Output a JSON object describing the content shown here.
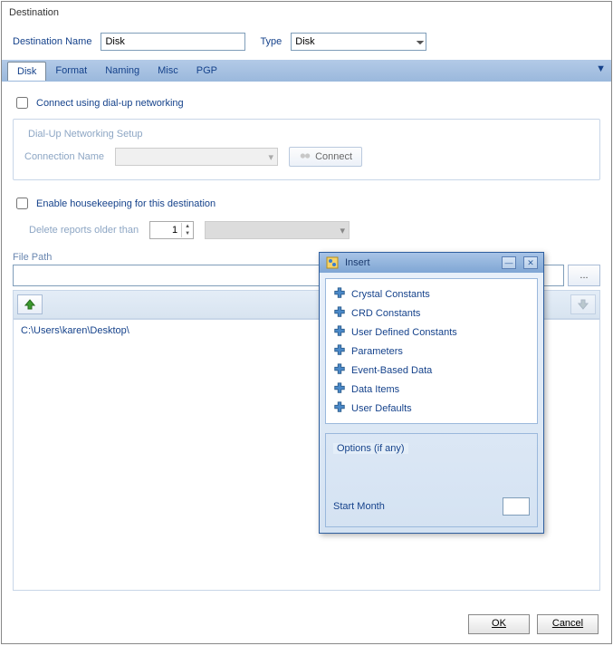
{
  "title": "Destination",
  "form": {
    "dest_name_label": "Destination Name",
    "dest_name_value": "Disk",
    "type_label": "Type",
    "type_value": "Disk"
  },
  "tabs": [
    "Disk",
    "Format",
    "Naming",
    "Misc",
    "PGP"
  ],
  "dialup": {
    "check_label": "Connect using dial-up networking",
    "group_label": "Dial-Up Networking Setup",
    "conn_label": "Connection Name",
    "connect_btn": "Connect"
  },
  "housekeeping": {
    "check_label": "Enable housekeeping for this destination",
    "delete_label": "Delete reports older than",
    "delete_value": "1"
  },
  "filepath": {
    "label": "File Path",
    "value": "",
    "browse": "...",
    "current_path": "C:\\Users\\karen\\Desktop\\"
  },
  "buttons": {
    "ok": "OK",
    "cancel": "Cancel"
  },
  "popup": {
    "title": "Insert",
    "items": [
      "Crystal Constants",
      "CRD Constants",
      "User Defined Constants",
      "Parameters",
      "Event-Based Data",
      "Data Items",
      "User Defaults"
    ],
    "options_label": "Options (if any)",
    "start_month_label": "Start Month"
  }
}
